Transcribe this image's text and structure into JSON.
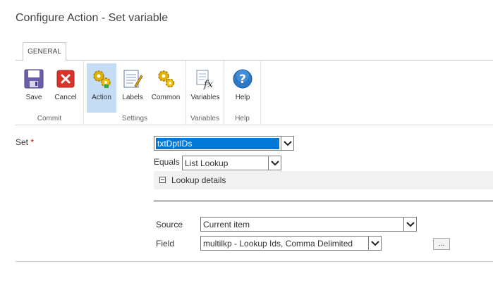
{
  "dialog": {
    "title": "Configure Action - Set variable"
  },
  "ribbon": {
    "tab": "GENERAL",
    "groups": {
      "commit": {
        "label": "Commit",
        "save": "Save",
        "cancel": "Cancel"
      },
      "settings": {
        "label": "Settings",
        "action": "Action",
        "labels": "Labels",
        "common": "Common"
      },
      "variables": {
        "label": "Variables",
        "variables": "Variables"
      },
      "help": {
        "label": "Help",
        "help": "Help"
      }
    },
    "icons": {
      "save": "floppy-disk-icon",
      "cancel": "red-x-icon",
      "action": "gears-icon",
      "labels": "notepad-pencil-icon",
      "common": "gears-icon",
      "variables": "formula-fx-icon",
      "help": "question-mark-icon"
    }
  },
  "form": {
    "set_label": "Set",
    "required_marker": "*",
    "set_value": "txtDptIDs",
    "equals_label": "Equals",
    "equals_value": "List Lookup",
    "lookup_details": "Lookup details",
    "source_label": "Source",
    "source_value": "Current item",
    "field_label": "Field",
    "field_value": "multilkp - Lookup Ids, Comma Delimited",
    "browse_button": "..."
  },
  "colors": {
    "selection": "#0078d7",
    "selected_ribbon_button": "#c5dcf5",
    "required": "#bf0000",
    "help_blue": "#2a78c6",
    "cancel_red": "#d9342b"
  }
}
